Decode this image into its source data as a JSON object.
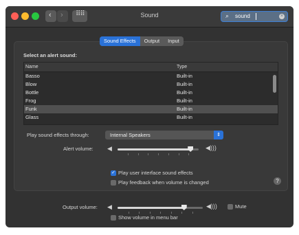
{
  "window": {
    "title": "Sound"
  },
  "search": {
    "value": "sound"
  },
  "tabs": [
    {
      "label": "Sound Effects"
    },
    {
      "label": "Output"
    },
    {
      "label": "Input"
    }
  ],
  "alert": {
    "heading": "Select an alert sound:",
    "columns": {
      "name": "Name",
      "type": "Type"
    },
    "rows": [
      {
        "name": "Basso",
        "type": "Built-in"
      },
      {
        "name": "Blow",
        "type": "Built-in"
      },
      {
        "name": "Bottle",
        "type": "Built-in"
      },
      {
        "name": "Frog",
        "type": "Built-in"
      },
      {
        "name": "Funk",
        "type": "Built-in"
      },
      {
        "name": "Glass",
        "type": "Built-in"
      }
    ],
    "selected": "Funk"
  },
  "effects": {
    "play_through_label": "Play sound effects through:",
    "play_through_value": "Internal Speakers",
    "alert_volume_label": "Alert volume:",
    "alert_volume_level": 0.9,
    "ui_sounds_label": "Play user interface sound effects",
    "ui_sounds_checked": true,
    "feedback_label": "Play feedback when volume is changed",
    "feedback_checked": false
  },
  "output": {
    "volume_label": "Output volume:",
    "volume_level": 0.78,
    "mute_label": "Mute",
    "mute_checked": false,
    "menu_bar_label": "Show volume in menu bar",
    "menu_bar_checked": false
  },
  "colors": {
    "accent": "#2a72d8",
    "window_bg": "#323232",
    "selection": "#505050"
  }
}
